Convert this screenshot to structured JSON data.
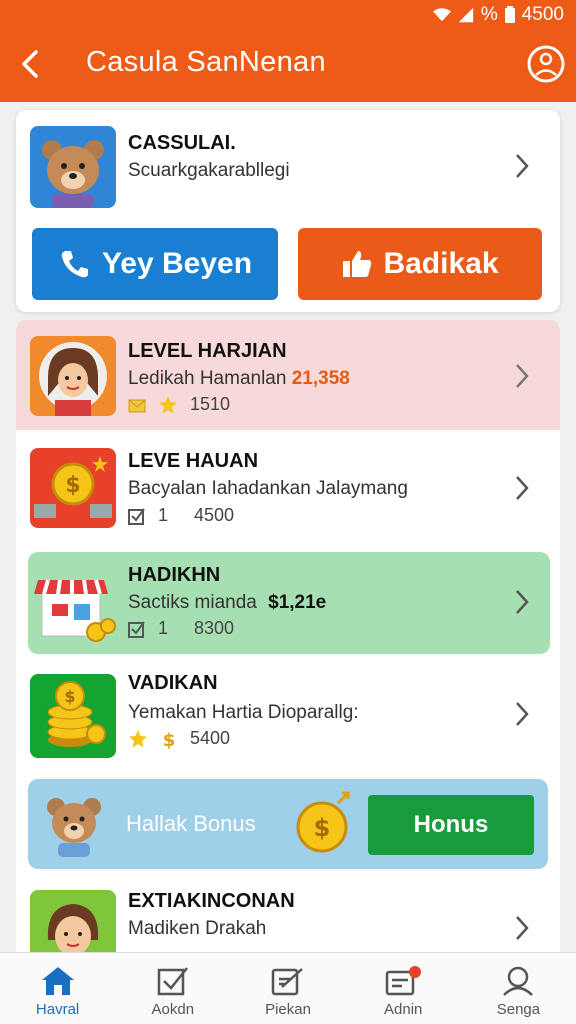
{
  "status_bar": {
    "battery_text": "% ",
    "number": "4500"
  },
  "header": {
    "title": "Casula SanNenan"
  },
  "top_card": {
    "name": "CASSULAI.",
    "subtitle": "Scuarkgakarabllegi",
    "btn_call_label": "Yey Beyen",
    "btn_like_label": "Badikak"
  },
  "list": [
    {
      "name": "LEVEL HARJIAN",
      "sub_prefix": "Ledikah Hamanlan",
      "amount": "21,358",
      "meta": "1510",
      "bg": "#f7d9d9"
    },
    {
      "name": "LEVE HAUAN",
      "sub_prefix": "Bacyalan Iahadankan Jalaymang",
      "amount": "",
      "meta_count": "1",
      "meta": "4500",
      "bg": "#ffffff"
    },
    {
      "name": "HADIKHN",
      "sub_prefix": "Sactiks mianda",
      "amount": "$1,21e",
      "meta_count": "1",
      "meta": "8300",
      "bg": "#a6dfb2"
    },
    {
      "name": "VADIKAN",
      "sub_prefix": "Yemakan Hartia Dioparallg:",
      "amount": "",
      "meta": "5400",
      "bg": "#ffffff"
    }
  ],
  "bonus": {
    "text": "Hallak Bonus",
    "button_label": "Honus"
  },
  "last_row": {
    "name": "EXTIAKINCONAN",
    "sub_prefix": "Madiken Drakah"
  },
  "bottom_nav": [
    {
      "label": "Havral",
      "icon": "home-icon",
      "active": true
    },
    {
      "label": "Aokdn",
      "icon": "checkbox-icon",
      "active": false
    },
    {
      "label": "Piekan",
      "icon": "edit-icon",
      "active": false
    },
    {
      "label": "Adnin",
      "icon": "inbox-icon",
      "active": false
    },
    {
      "label": "Senga",
      "icon": "person-icon",
      "active": false
    }
  ],
  "colors": {
    "header": "#ee5b17",
    "blue_button": "#1a7fd1",
    "orange_button": "#ea5b1a",
    "green_button": "#179b3c"
  }
}
